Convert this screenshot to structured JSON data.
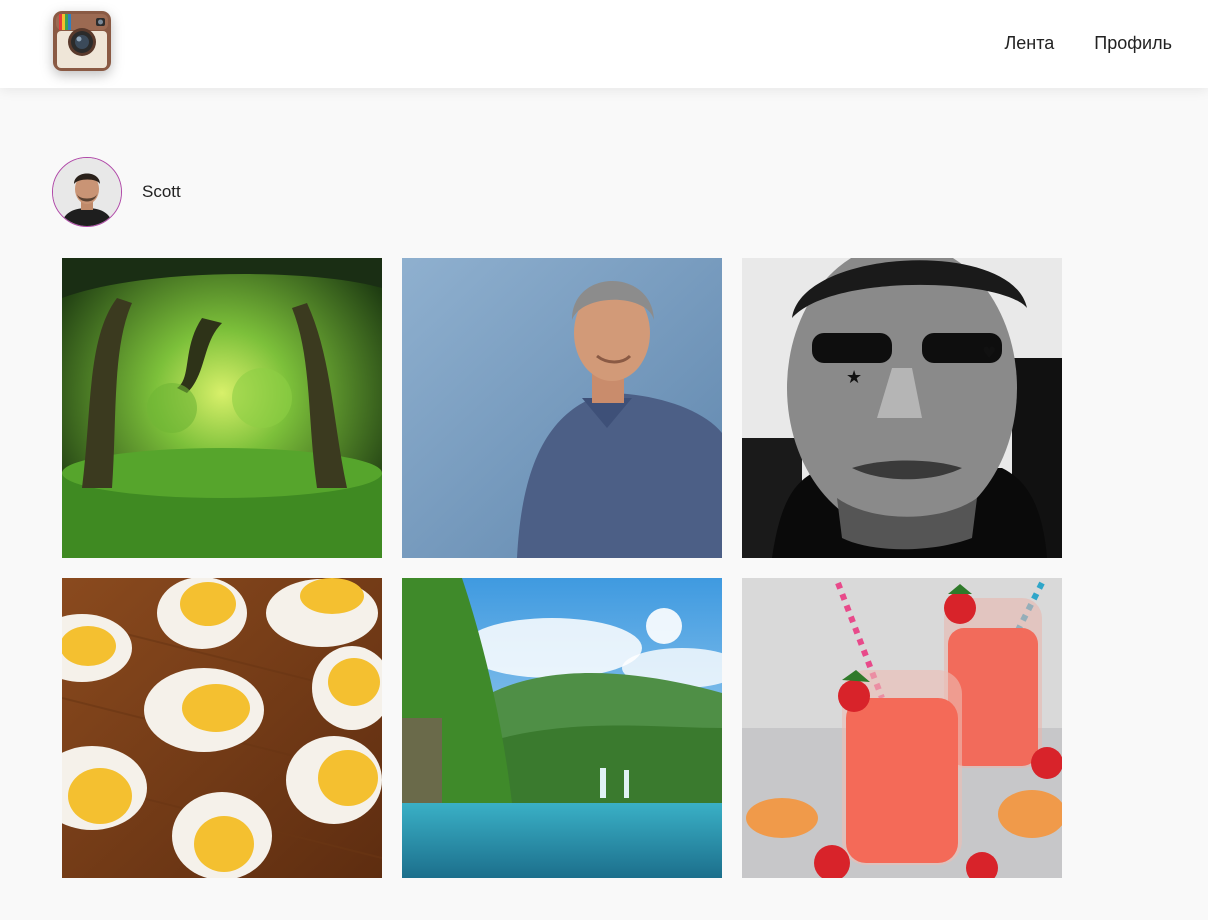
{
  "header": {
    "logo_icon": "instagram-camera-logo-icon",
    "nav": [
      {
        "label": "Лента",
        "icon": null
      },
      {
        "label": "Профиль",
        "icon": null
      }
    ]
  },
  "profile": {
    "username": "Scott",
    "avatar_icon": "user-avatar-photo",
    "avatar_border_color": "#b048a8"
  },
  "posts": [
    {
      "icon": "forest-photo"
    },
    {
      "icon": "man-blue-shirt-portrait-photo"
    },
    {
      "icon": "tattooed-man-bw-portrait-photo"
    },
    {
      "icon": "boiled-eggs-photo"
    },
    {
      "icon": "lake-mountains-landscape-photo"
    },
    {
      "icon": "strawberry-smoothie-jars-photo"
    }
  ],
  "colors": {
    "page_bg": "#f9f9f9",
    "header_bg": "#ffffff",
    "text": "#222222"
  }
}
